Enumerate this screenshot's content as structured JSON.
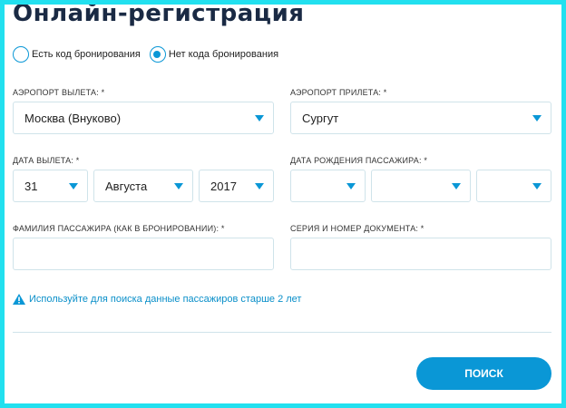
{
  "title": "Онлайн-регистрация",
  "radio": {
    "option1": "Есть код бронирования",
    "option2": "Нет кода бронирования",
    "selected": "option2"
  },
  "departure": {
    "label": "АЭРОПОРТ ВЫЛЕТА: *",
    "value": "Москва (Внуково)"
  },
  "arrival": {
    "label": "АЭРОПОРТ ПРИЛЕТА: *",
    "value": "Сургут"
  },
  "departure_date": {
    "label": "ДАТА ВЫЛЕТА: *",
    "day": "31",
    "month": "Августа",
    "year": "2017"
  },
  "birth_date": {
    "label": "ДАТА РОЖДЕНИЯ ПАССАЖИРА: *",
    "day": "",
    "month": "",
    "year": ""
  },
  "surname": {
    "label": "ФАМИЛИЯ ПАССАЖИРА (КАК В БРОНИРОВАНИИ): *",
    "value": ""
  },
  "document": {
    "label": "СЕРИЯ И НОМЕР ДОКУМЕНТА: *",
    "value": ""
  },
  "note": "Используйте для поиска данные пассажиров старше 2 лет",
  "search_button": "ПОИСК",
  "colors": {
    "accent": "#0a97d6",
    "title": "#1a2a44",
    "frame": "#22e0ef",
    "border": "#cfe3ea"
  }
}
